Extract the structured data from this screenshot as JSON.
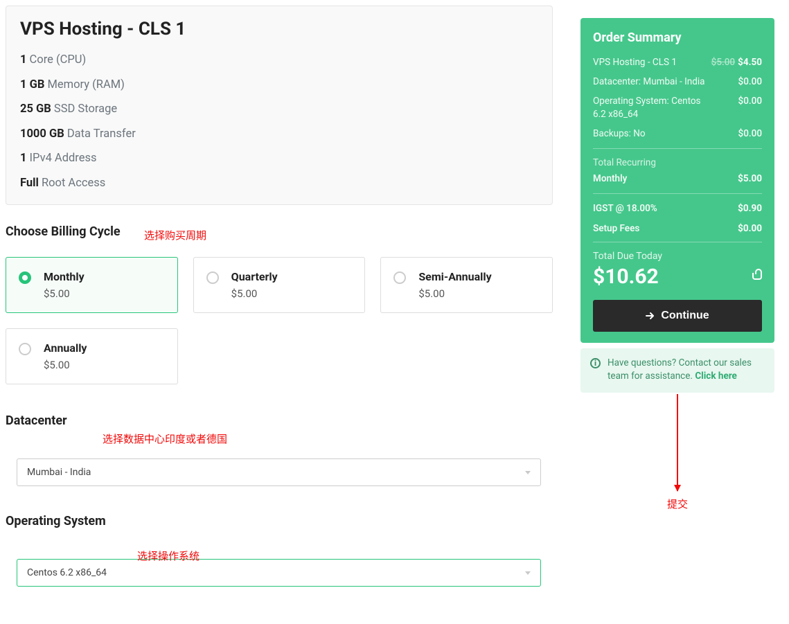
{
  "product": {
    "title": "VPS Hosting - CLS 1",
    "specs": [
      {
        "b": "1",
        "t": " Core (CPU)"
      },
      {
        "b": "1 GB",
        "t": " Memory (RAM)"
      },
      {
        "b": "25 GB",
        "t": " SSD Storage"
      },
      {
        "b": "1000 GB",
        "t": " Data Transfer"
      },
      {
        "b": "1",
        "t": " IPv4 Address"
      },
      {
        "b": "Full",
        "t": " Root Access"
      }
    ]
  },
  "billing": {
    "title": "Choose Billing Cycle",
    "annotation": "选择购买周期",
    "options": [
      {
        "label": "Monthly",
        "price": "$5.00",
        "selected": true
      },
      {
        "label": "Quarterly",
        "price": "$5.00",
        "selected": false
      },
      {
        "label": "Semi-Annually",
        "price": "$5.00",
        "selected": false
      },
      {
        "label": "Annually",
        "price": "$5.00",
        "selected": false
      }
    ]
  },
  "datacenter": {
    "title": "Datacenter",
    "annotation": "选择数据中心印度或者德国",
    "value": "Mumbai - India"
  },
  "os": {
    "title": "Operating System",
    "annotation": "选择操作系统",
    "value": "Centos 6.2 x86_64"
  },
  "summary": {
    "title": "Order Summary",
    "items": [
      {
        "k": "VPS Hosting - CLS 1",
        "strike": "$5.00",
        "v": "$4.50"
      },
      {
        "k": "Datacenter: Mumbai - India",
        "v": "$0.00"
      },
      {
        "k": "Operating System: Centos 6.2 x86_64",
        "v": "$0.00"
      },
      {
        "k": "Backups: No",
        "v": "$0.00"
      }
    ],
    "recurring_label": "Total Recurring",
    "recurring_cycle": "Monthly",
    "recurring_amount": "$5.00",
    "tax_label": "IGST @ 18.00%",
    "tax_amount": "$0.90",
    "setup_label": "Setup Fees",
    "setup_amount": "$0.00",
    "due_label": "Total Due Today",
    "due_amount": "$10.62",
    "cta": "Continue",
    "submit_annotation": "提交"
  },
  "note": {
    "text": "Have questions? Contact our sales team for assistance. ",
    "link": "Click here"
  }
}
